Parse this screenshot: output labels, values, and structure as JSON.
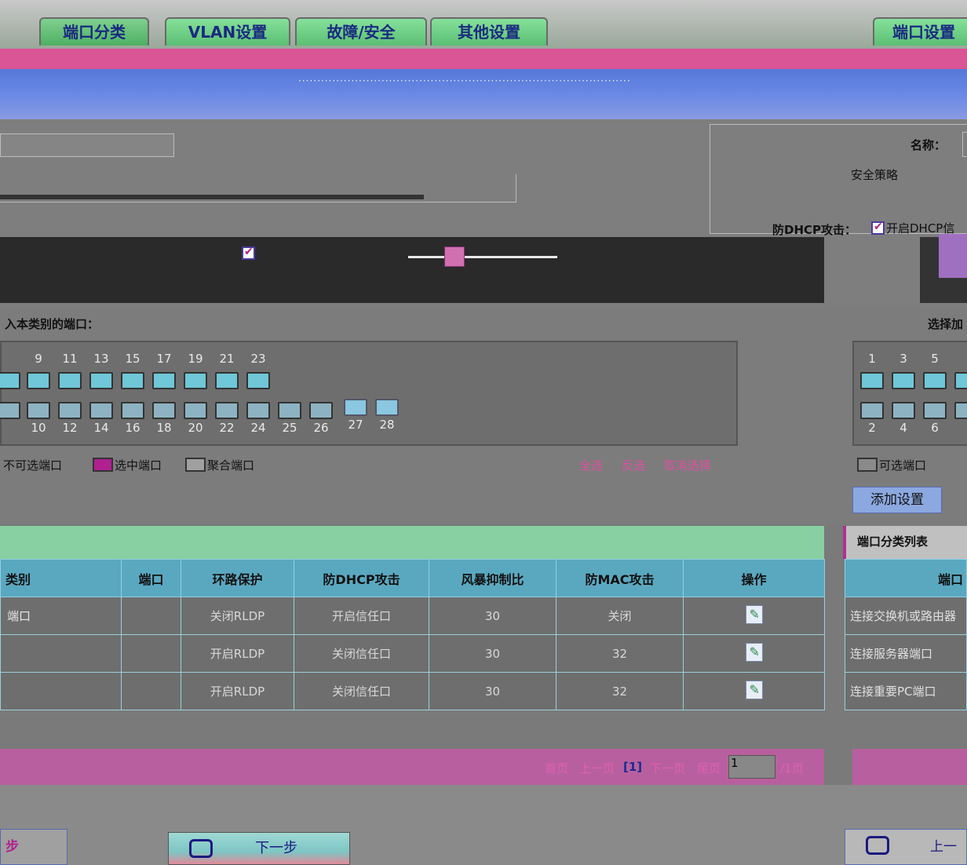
{
  "tabs": [
    {
      "label": "端口分类"
    },
    {
      "label": "VLAN设置"
    },
    {
      "label": "故障/安全"
    },
    {
      "label": "其他设置"
    }
  ],
  "right_tab": "端口设置",
  "config": {
    "name_label": "名称：",
    "security_label": "安全策略",
    "dhcp_label": "防DHCP攻击：",
    "dhcp_option": "开启DHCP信"
  },
  "ports_left": {
    "title": "入本类别的端口：",
    "top_numbers": [
      "9",
      "11",
      "13",
      "15",
      "17",
      "19",
      "21",
      "23"
    ],
    "bottom_numbers": [
      "10",
      "12",
      "14",
      "16",
      "18",
      "20",
      "22",
      "24",
      "25",
      "26",
      "27",
      "28"
    ],
    "legend": [
      "不可选端口",
      "选中端口",
      "聚合端口"
    ],
    "actions": [
      "全选",
      "反选",
      "取消选择"
    ]
  },
  "ports_right": {
    "title": "选择加",
    "top_numbers": [
      "1",
      "3",
      "5"
    ],
    "bottom_numbers": [
      "2",
      "4",
      "6"
    ],
    "legend": [
      "可选端口"
    ],
    "add_button": "添加设置"
  },
  "table": {
    "headers": [
      "类别",
      "端口",
      "环路保护",
      "防DHCP攻击",
      "风暴抑制比",
      "防MAC攻击",
      "操作"
    ],
    "rows": [
      {
        "category": "端口",
        "port": "",
        "loop": "关闭RLDP",
        "dhcp": "开启信任口",
        "storm": "30",
        "mac": "关闭"
      },
      {
        "category": "",
        "port": "",
        "loop": "开启RLDP",
        "dhcp": "关闭信任口",
        "storm": "30",
        "mac": "32"
      },
      {
        "category": "",
        "port": "",
        "loop": "开启RLDP",
        "dhcp": "关闭信任口",
        "storm": "30",
        "mac": "32"
      }
    ]
  },
  "side_list": {
    "title": "端口分类列表",
    "header": "端口",
    "rows": [
      "连接交换机或路由器",
      "连接服务器端口",
      "连接重要PC端口"
    ]
  },
  "pager": {
    "first": "首页",
    "prev": "上一页",
    "current": "[1]",
    "next": "下一页",
    "last": "尾页",
    "page_value": "1",
    "total": "/1页"
  },
  "footer": {
    "left_label": "步",
    "next_label": "下一步",
    "right_label": "上一"
  }
}
